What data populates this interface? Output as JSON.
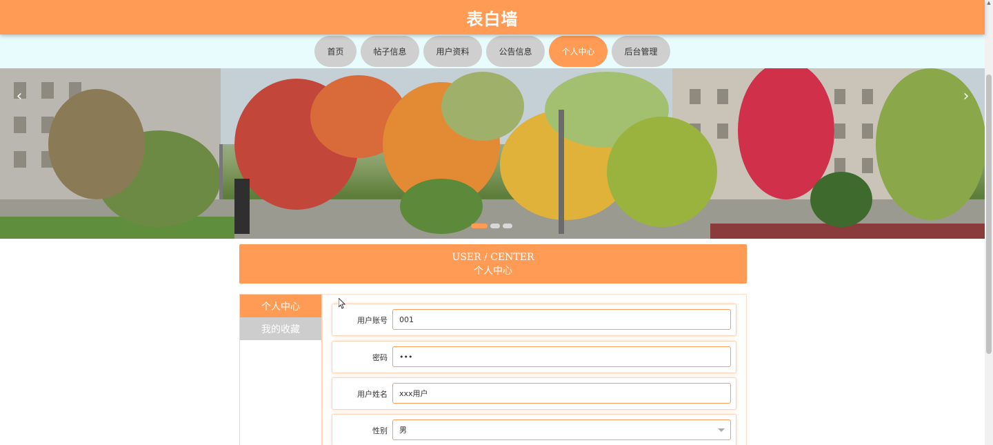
{
  "header": {
    "title": "表白墙"
  },
  "nav": {
    "items": [
      {
        "label": "首页",
        "active": false
      },
      {
        "label": "帖子信息",
        "active": false
      },
      {
        "label": "用户资料",
        "active": false
      },
      {
        "label": "公告信息",
        "active": false
      },
      {
        "label": "个人中心",
        "active": true
      },
      {
        "label": "后台管理",
        "active": false
      }
    ]
  },
  "banner": {
    "prev_icon": "chevron-left-icon",
    "next_icon": "chevron-right-icon",
    "slide_count": 3,
    "active_slide": 1
  },
  "section": {
    "title_en": "USER / CENTER",
    "title_cn": "个人中心"
  },
  "sidebar": {
    "items": [
      {
        "label": "个人中心",
        "active": true
      },
      {
        "label": "我的收藏",
        "active": false
      }
    ]
  },
  "form": {
    "fields": [
      {
        "label": "用户账号",
        "value": "001",
        "type": "text"
      },
      {
        "label": "密码",
        "value": "•••",
        "type": "password"
      },
      {
        "label": "用户姓名",
        "value": "xxx用户",
        "type": "text"
      },
      {
        "label": "性别",
        "value": "男",
        "type": "select"
      }
    ]
  },
  "colors": {
    "accent": "#ff9b55",
    "nav_bg": "#e9fcfd",
    "inactive": "#cfcfcf"
  }
}
